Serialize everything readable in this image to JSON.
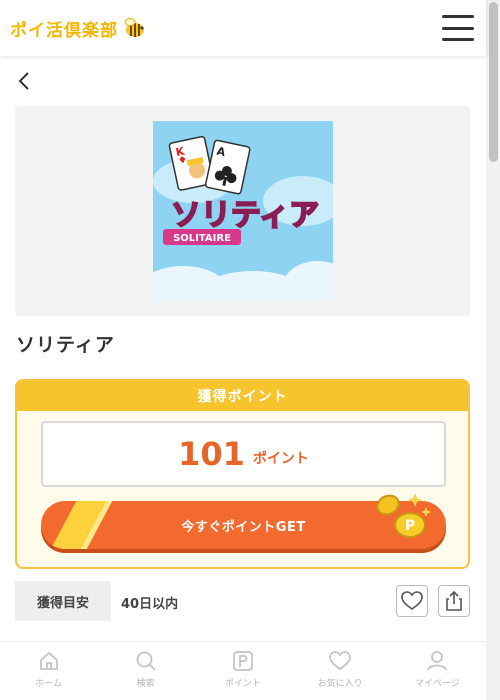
{
  "header": {
    "logo_text": "ポイ活倶楽部",
    "logo_icon": "bee-icon",
    "menu_icon": "hamburger-menu-icon"
  },
  "nav": {
    "back_icon": "chevron-left-icon"
  },
  "app": {
    "title": "ソリティア",
    "thumbnail_title": "ソリティア",
    "thumbnail_subtitle": "SOLITAIRE"
  },
  "points": {
    "header": "獲得ポイント",
    "value": "101",
    "unit": "ポイント",
    "button_label": "今すぐポイントGET"
  },
  "estimate": {
    "label": "獲得目安",
    "value": "40日以内"
  },
  "actions": {
    "favorite_icon": "heart-icon",
    "share_icon": "share-icon"
  },
  "bottom_nav": [
    {
      "label": "ホーム",
      "icon": "home-icon"
    },
    {
      "label": "検索",
      "icon": "search-icon"
    },
    {
      "label": "ポイント",
      "icon": "point-p-icon"
    },
    {
      "label": "お気に入り",
      "icon": "heart-icon"
    },
    {
      "label": "マイページ",
      "icon": "user-icon"
    }
  ],
  "colors": {
    "brand_yellow": "#f6c42c",
    "accent_orange": "#f26a2e",
    "points_text": "#e8652a"
  }
}
